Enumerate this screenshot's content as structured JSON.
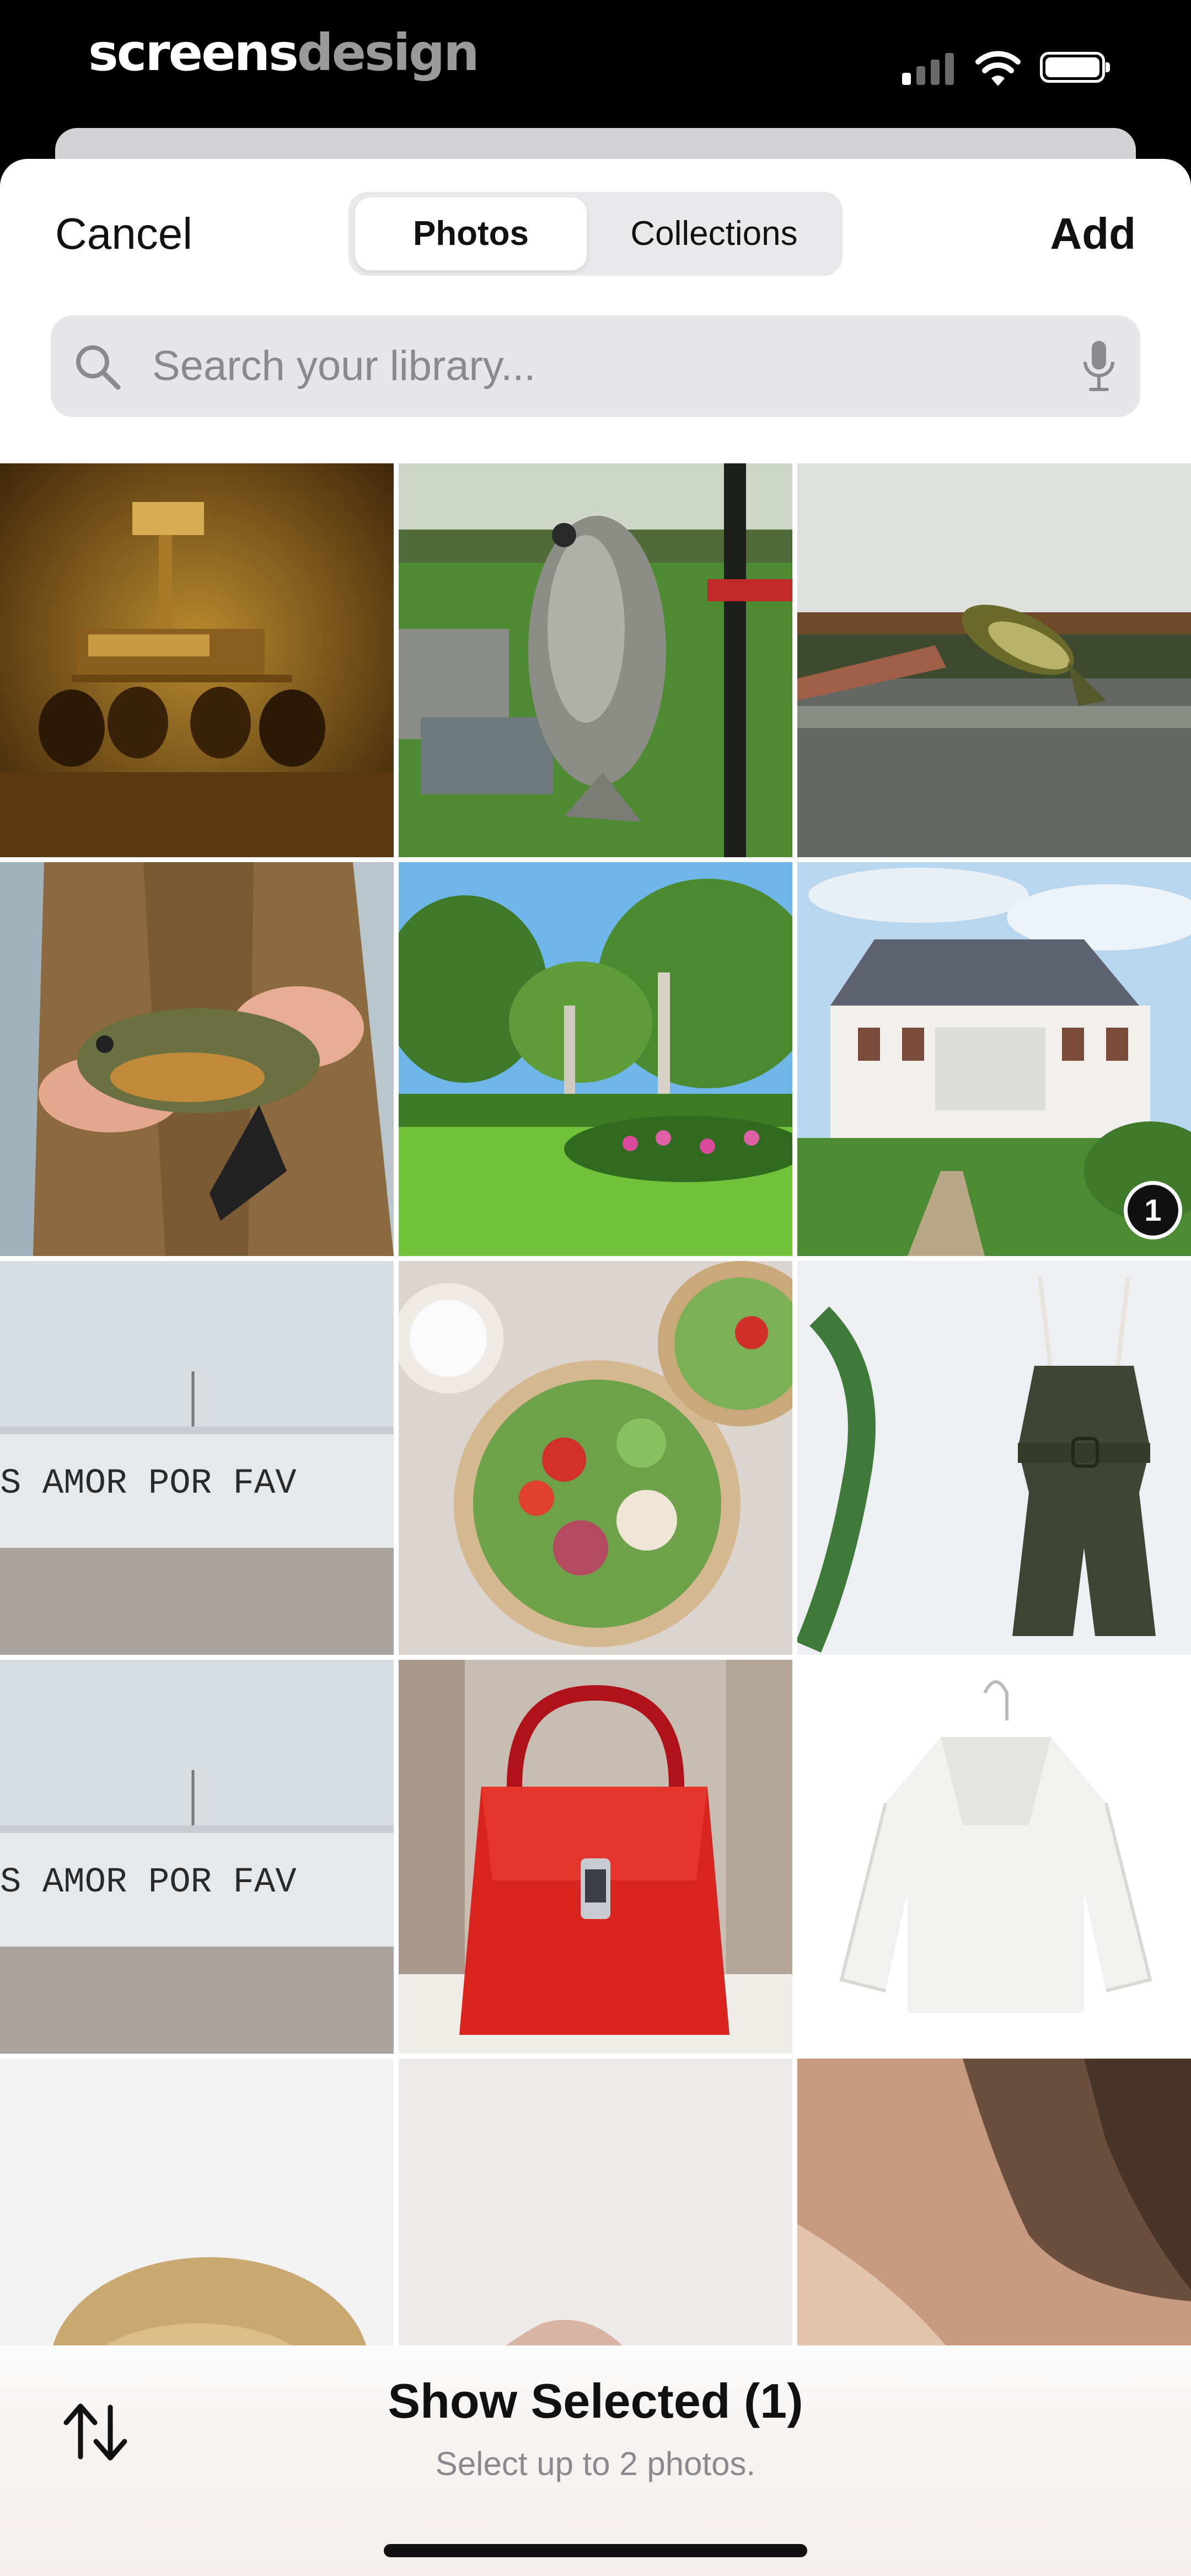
{
  "status_bar": {
    "brand_part1": "screens",
    "brand_part2": "design"
  },
  "header": {
    "cancel_label": "Cancel",
    "add_label": "Add",
    "tabs": [
      {
        "label": "Photos",
        "active": true
      },
      {
        "label": "Collections",
        "active": false
      }
    ]
  },
  "search": {
    "placeholder": "Search your library..."
  },
  "grid": {
    "photos": [
      {
        "subject": "sepia rover painting"
      },
      {
        "subject": "fish held over lawn"
      },
      {
        "subject": "bass held over lake"
      },
      {
        "subject": "sunfish in hands"
      },
      {
        "subject": "garden with trees"
      },
      {
        "subject": "white manor house",
        "selected_index": "1"
      },
      {
        "subject": "amor por favor wall",
        "wall_text": "S AMOR POR FAV"
      },
      {
        "subject": "salad bowls"
      },
      {
        "subject": "dark green romper"
      },
      {
        "subject": "amor por favor wall",
        "wall_text": "S AMOR POR FAV"
      },
      {
        "subject": "red handbag"
      },
      {
        "subject": "white fleece jacket"
      },
      {
        "subject": "blonde woman"
      },
      {
        "subject": "skin closeup"
      },
      {
        "subject": "neck closeup"
      }
    ]
  },
  "bottom_bar": {
    "show_selected_label": "Show Selected (1)",
    "hint": "Select up to 2 photos."
  },
  "colors": {
    "accent": "#111111",
    "sheet": "#ffffff",
    "search_bg": "#e6e6ea"
  }
}
